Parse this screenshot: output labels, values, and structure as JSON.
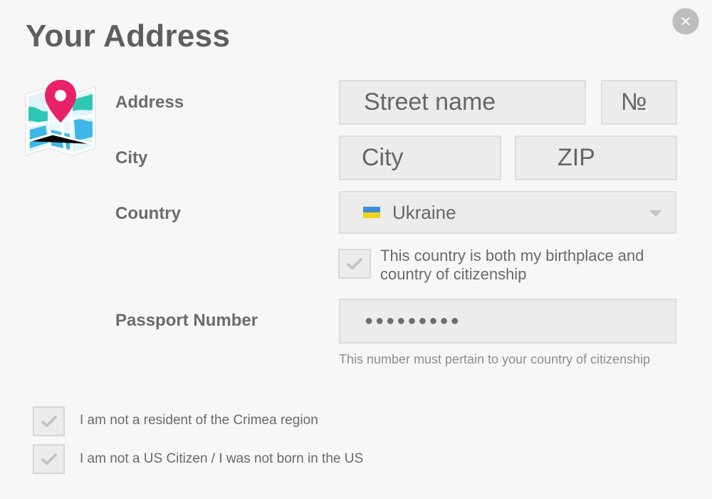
{
  "header": {
    "title": "Your Address"
  },
  "close_button": {
    "icon": "close-icon",
    "glyph": "✕"
  },
  "form": {
    "address": {
      "label": "Address",
      "street_placeholder": "Street name",
      "number_placeholder": "№"
    },
    "city": {
      "label": "City",
      "city_placeholder": "City",
      "zip_placeholder": "ZIP"
    },
    "country": {
      "label": "Country",
      "selected": "Ukraine",
      "flag_colors": [
        "#3b8fd9",
        "#f2d21b"
      ],
      "birthplace_checkbox": {
        "text_line1": "This country is both my birthplace and",
        "text_line2": "country of citizenship",
        "checked": true
      }
    },
    "passport": {
      "label": "Passport Number",
      "value": "●●●●●●●●●",
      "hint": "This number must pertain to your country of citizenship"
    }
  },
  "confirmations": [
    {
      "text": "I am not a resident of the Crimea region",
      "checked": true
    },
    {
      "text": "I am not a US Citizen / I was not born in the US",
      "checked": true
    }
  ],
  "colors": {
    "background": "#f7f7f7",
    "field_bg": "#ececec",
    "pin": "#e8226a",
    "map_teal": "#21c9b8",
    "map_blue": "#3fb6e8"
  }
}
